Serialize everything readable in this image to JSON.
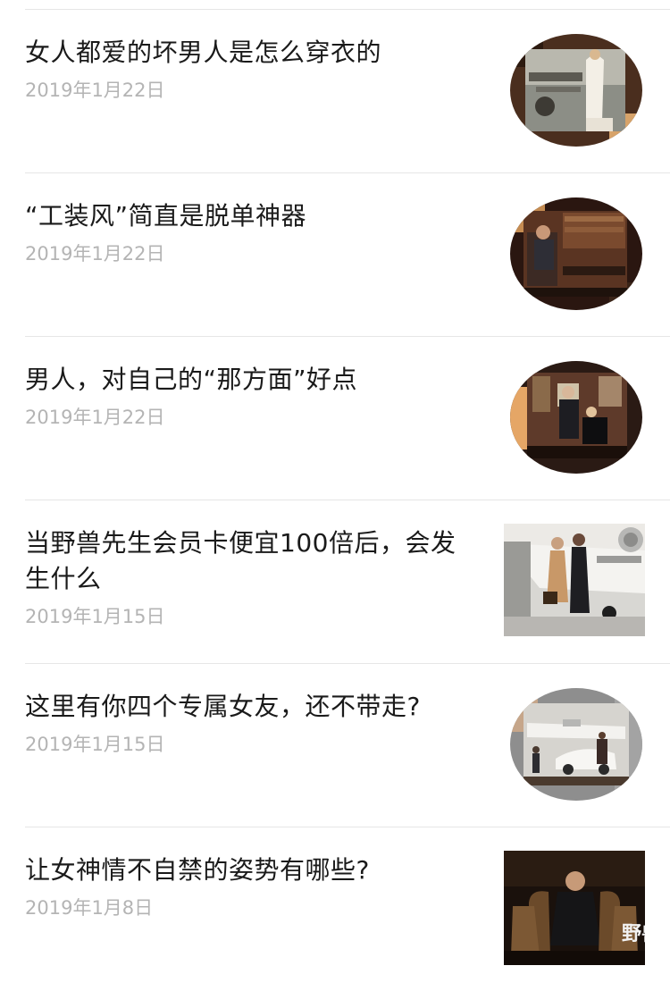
{
  "articles": [
    {
      "title": "女人都爱的坏男人是怎么穿衣的",
      "date": "2019年1月22日",
      "thumb_icon": "fashion-airplane-photo",
      "thumb_shape": "circle"
    },
    {
      "title": "“工装风”简直是脱单神器",
      "date": "2019年1月22日",
      "thumb_icon": "man-in-library-photo",
      "thumb_shape": "circle"
    },
    {
      "title": "男人，对自己的“那方面”好点",
      "date": "2019年1月22日",
      "thumb_icon": "couple-in-room-photo",
      "thumb_shape": "circle"
    },
    {
      "title": "当野兽先生会员卡便宜100倍后，会发生什么",
      "date": "2019年1月15日",
      "thumb_icon": "couple-private-jet-photo",
      "thumb_shape": "rect"
    },
    {
      "title": "这里有你四个专属女友，还不带走?",
      "date": "2019年1月15日",
      "thumb_icon": "sports-car-jet-photo",
      "thumb_shape": "circle"
    },
    {
      "title": "让女神情不自禁的姿势有哪些?",
      "date": "2019年1月8日",
      "thumb_icon": "man-in-armchair-photo",
      "thumb_shape": "rect"
    }
  ],
  "thumb6_overlay": "野兽",
  "colors": {
    "title": "#1a1a1a",
    "date": "#b4b4b4",
    "divider": "#e6e6e6",
    "thumb_brown": "#3a2418",
    "thumb_tan": "#c8955c"
  }
}
